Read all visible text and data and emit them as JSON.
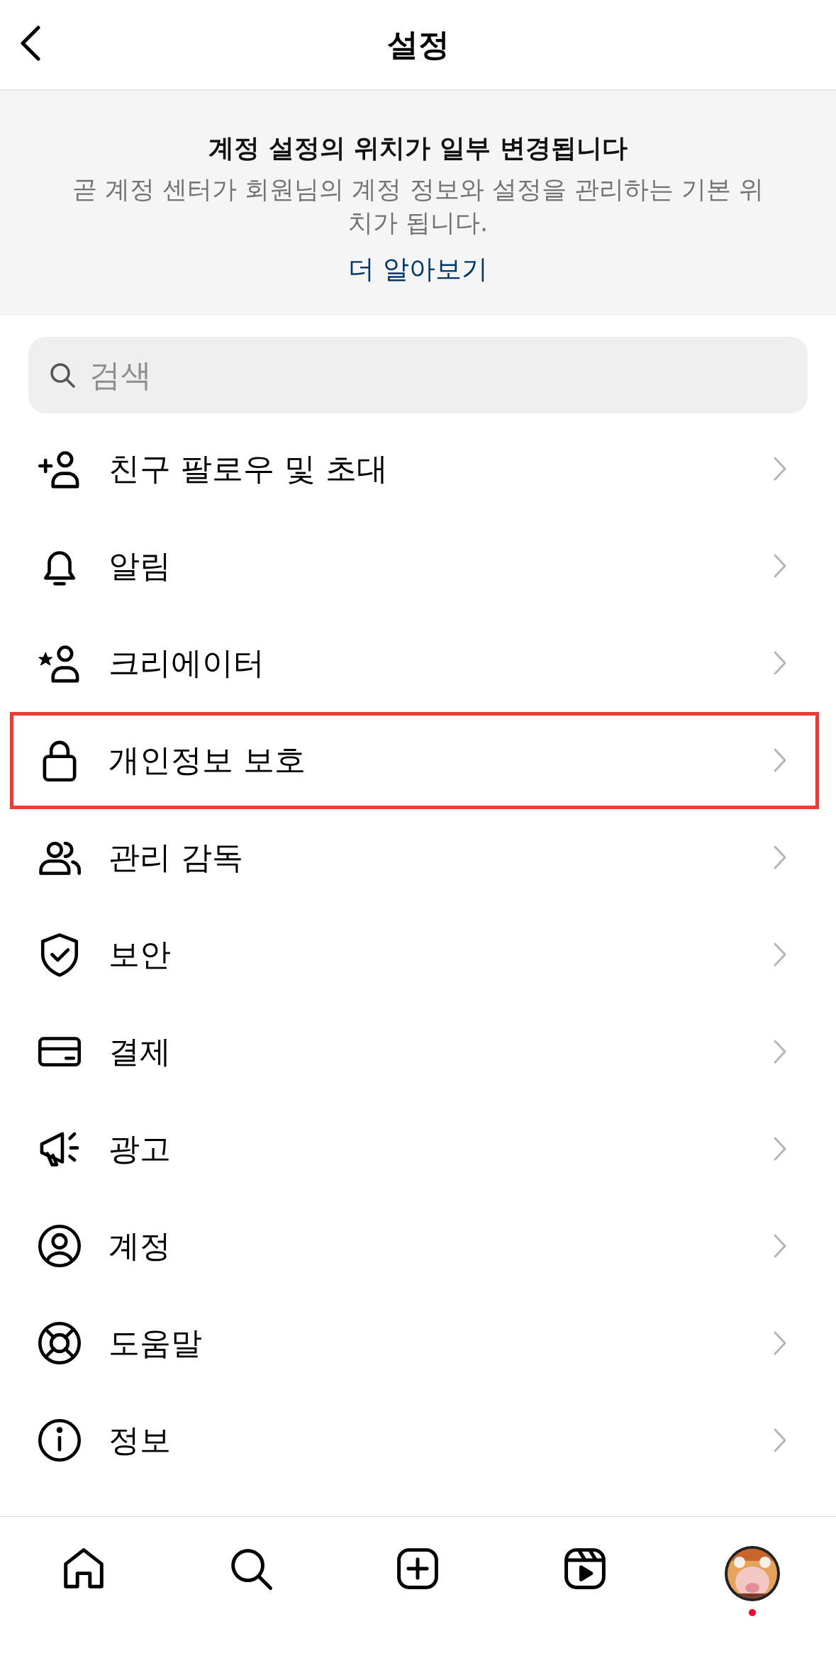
{
  "header": {
    "title": "설정"
  },
  "notice": {
    "title": "계정 설정의 위치가 일부 변경됩니다",
    "body": "곧 계정 센터가 회원님의 계정 정보와 설정을 관리하는 기본 위치가 됩니다.",
    "link": "더 알아보기"
  },
  "search": {
    "placeholder": "검색"
  },
  "items": [
    {
      "label": "친구 팔로우 및 초대",
      "highlighted": false
    },
    {
      "label": "알림",
      "highlighted": false
    },
    {
      "label": "크리에이터",
      "highlighted": false
    },
    {
      "label": "개인정보 보호",
      "highlighted": true
    },
    {
      "label": "관리 감독",
      "highlighted": false
    },
    {
      "label": "보안",
      "highlighted": false
    },
    {
      "label": "결제",
      "highlighted": false
    },
    {
      "label": "광고",
      "highlighted": false
    },
    {
      "label": "계정",
      "highlighted": false
    },
    {
      "label": "도움말",
      "highlighted": false
    },
    {
      "label": "정보",
      "highlighted": false
    }
  ],
  "nav": [
    {
      "kind": "home"
    },
    {
      "kind": "search"
    },
    {
      "kind": "create"
    },
    {
      "kind": "reels"
    },
    {
      "kind": "profile",
      "notification": true
    }
  ]
}
